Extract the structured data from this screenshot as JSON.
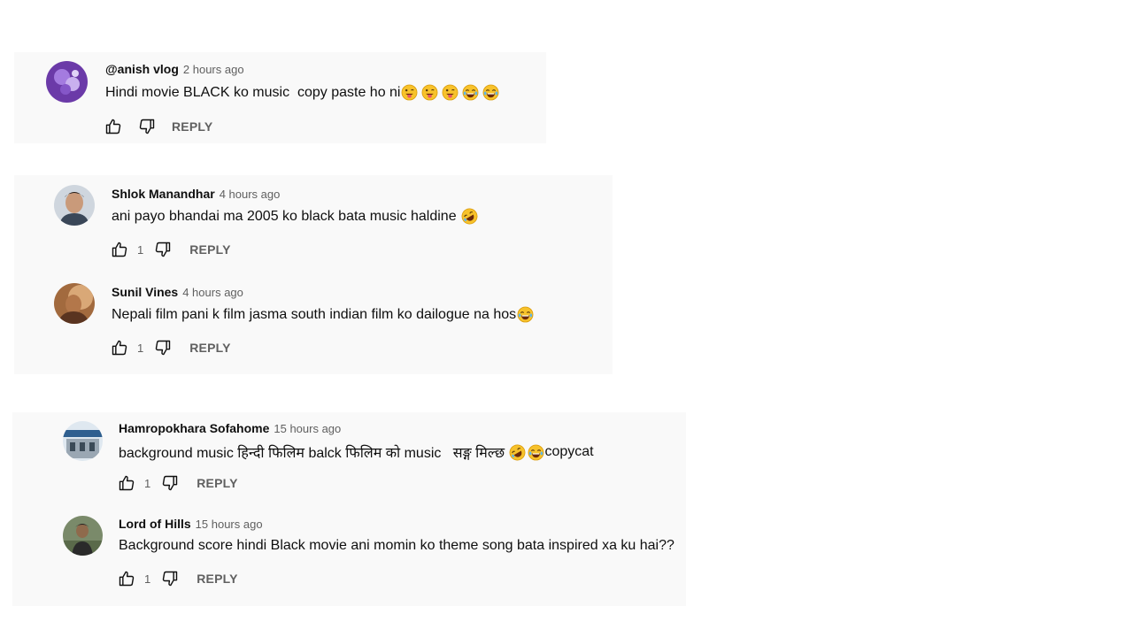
{
  "threads": [
    {
      "comments": [
        {
          "author": "@anish vlog",
          "time": "2 hours ago",
          "text": "Hindi movie BLACK ko music  copy paste ho ni",
          "emojis": [
            "tongue-wink-emoji",
            "tongue-wink-emoji",
            "tongue-wink-emoji",
            "tears-of-joy-emoji",
            "tears-of-joy-emoji"
          ],
          "likes": "",
          "reply_label": "REPLY"
        }
      ]
    },
    {
      "comments": [
        {
          "author": "Shlok Manandhar",
          "time": "4 hours ago",
          "text": "ani payo bhandai ma 2005 ko black bata music haldine ",
          "emojis": [
            "rofl-emoji"
          ],
          "likes": "1",
          "reply_label": "REPLY"
        },
        {
          "author": "Sunil Vines",
          "time": "4 hours ago",
          "text": "Nepali film pani k film jasma south indian film ko dailogue na hos",
          "emojis": [
            "tears-of-joy-emoji"
          ],
          "likes": "1",
          "reply_label": "REPLY"
        }
      ]
    },
    {
      "comments": [
        {
          "author": "Hamropokhara Sofahome",
          "time": "15 hours ago",
          "text": "background music हिन्दी फिलिम balck फिलिम को music   सङ्ग मिल्छ ",
          "text_suffix": "copycat",
          "emojis": [
            "rofl-emoji",
            "tears-of-joy-emoji"
          ],
          "likes": "1",
          "reply_label": "REPLY"
        },
        {
          "author": "Lord of Hills",
          "time": "15 hours ago",
          "text": "Background score hindi Black movie ani momin ko theme song bata inspired xa ku hai??",
          "emojis": [],
          "likes": "1",
          "reply_label": "REPLY"
        }
      ]
    }
  ]
}
